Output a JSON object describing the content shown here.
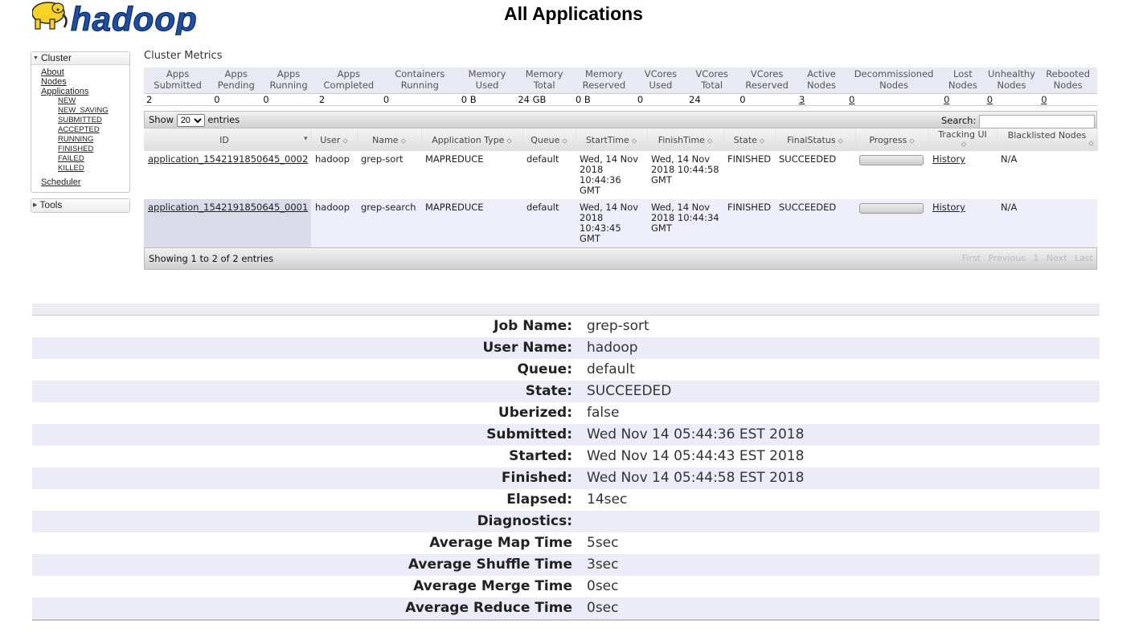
{
  "page": {
    "title": "All Applications"
  },
  "logo": {
    "text": "hadoop"
  },
  "nav": {
    "cluster": "Cluster",
    "cluster_links": [
      "About",
      "Nodes",
      "Applications"
    ],
    "app_states": [
      "NEW",
      "NEW_SAVING",
      "SUBMITTED",
      "ACCEPTED",
      "RUNNING",
      "FINISHED",
      "FAILED",
      "KILLED"
    ],
    "scheduler": "Scheduler",
    "tools": "Tools"
  },
  "metrics": {
    "title": "Cluster Metrics",
    "headers": [
      "Apps Submitted",
      "Apps Pending",
      "Apps Running",
      "Apps Completed",
      "Containers Running",
      "Memory Used",
      "Memory Total",
      "Memory Reserved",
      "VCores Used",
      "VCores Total",
      "VCores Reserved",
      "Active Nodes",
      "Decommissioned Nodes",
      "Lost Nodes",
      "Unhealthy Nodes",
      "Rebooted Nodes"
    ],
    "values": [
      "2",
      "0",
      "0",
      "2",
      "0",
      "0 B",
      "24 GB",
      "0 B",
      "0",
      "24",
      "0",
      "3",
      "0",
      "0",
      "0",
      "0"
    ]
  },
  "apps": {
    "show_label": "Show",
    "show_value": "20",
    "entries_label": "entries",
    "search_label": "Search:",
    "headers": [
      "ID",
      "User",
      "Name",
      "Application Type",
      "Queue",
      "StartTime",
      "FinishTime",
      "State",
      "FinalStatus",
      "Progress",
      "Tracking UI",
      "Blacklisted Nodes"
    ],
    "rows": [
      {
        "id": "application_1542191850645_0002",
        "user": "hadoop",
        "name": "grep-sort",
        "type": "MAPREDUCE",
        "queue": "default",
        "start": "Wed, 14 Nov 2018 10:44:36 GMT",
        "finish": "Wed, 14 Nov 2018 10:44:58 GMT",
        "state": "FINISHED",
        "final": "SUCCEEDED",
        "progress": 1.0,
        "tracking": "History",
        "blacklisted": "N/A"
      },
      {
        "id": "application_1542191850645_0001",
        "user": "hadoop",
        "name": "grep-search",
        "type": "MAPREDUCE",
        "queue": "default",
        "start": "Wed, 14 Nov 2018 10:43:45 GMT",
        "finish": "Wed, 14 Nov 2018 10:44:34 GMT",
        "state": "FINISHED",
        "final": "SUCCEEDED",
        "progress": 1.0,
        "tracking": "History",
        "blacklisted": "N/A"
      }
    ],
    "showing": "Showing 1 to 2 of 2 entries",
    "pagination": [
      "First",
      "Previous",
      "1",
      "Next",
      "Last"
    ]
  },
  "job": {
    "rows": [
      {
        "label": "Job Name:",
        "value": "grep-sort"
      },
      {
        "label": "User Name:",
        "value": "hadoop"
      },
      {
        "label": "Queue:",
        "value": "default"
      },
      {
        "label": "State:",
        "value": "SUCCEEDED"
      },
      {
        "label": "Uberized:",
        "value": "false"
      },
      {
        "label": "Submitted:",
        "value": "Wed Nov 14 05:44:36 EST 2018"
      },
      {
        "label": "Started:",
        "value": "Wed Nov 14 05:44:43 EST 2018"
      },
      {
        "label": "Finished:",
        "value": "Wed Nov 14 05:44:58 EST 2018"
      },
      {
        "label": "Elapsed:",
        "value": "14sec"
      },
      {
        "label": "Diagnostics:",
        "value": ""
      },
      {
        "label": "Average Map Time",
        "value": "5sec"
      },
      {
        "label": "Average Shuffle Time",
        "value": "3sec"
      },
      {
        "label": "Average Merge Time",
        "value": "0sec"
      },
      {
        "label": "Average Reduce Time",
        "value": "0sec"
      }
    ]
  },
  "colors": {
    "logo_blue": "#1f4fa3",
    "logo_yellow": "#f7d226",
    "row_even": "#eeeefa"
  }
}
